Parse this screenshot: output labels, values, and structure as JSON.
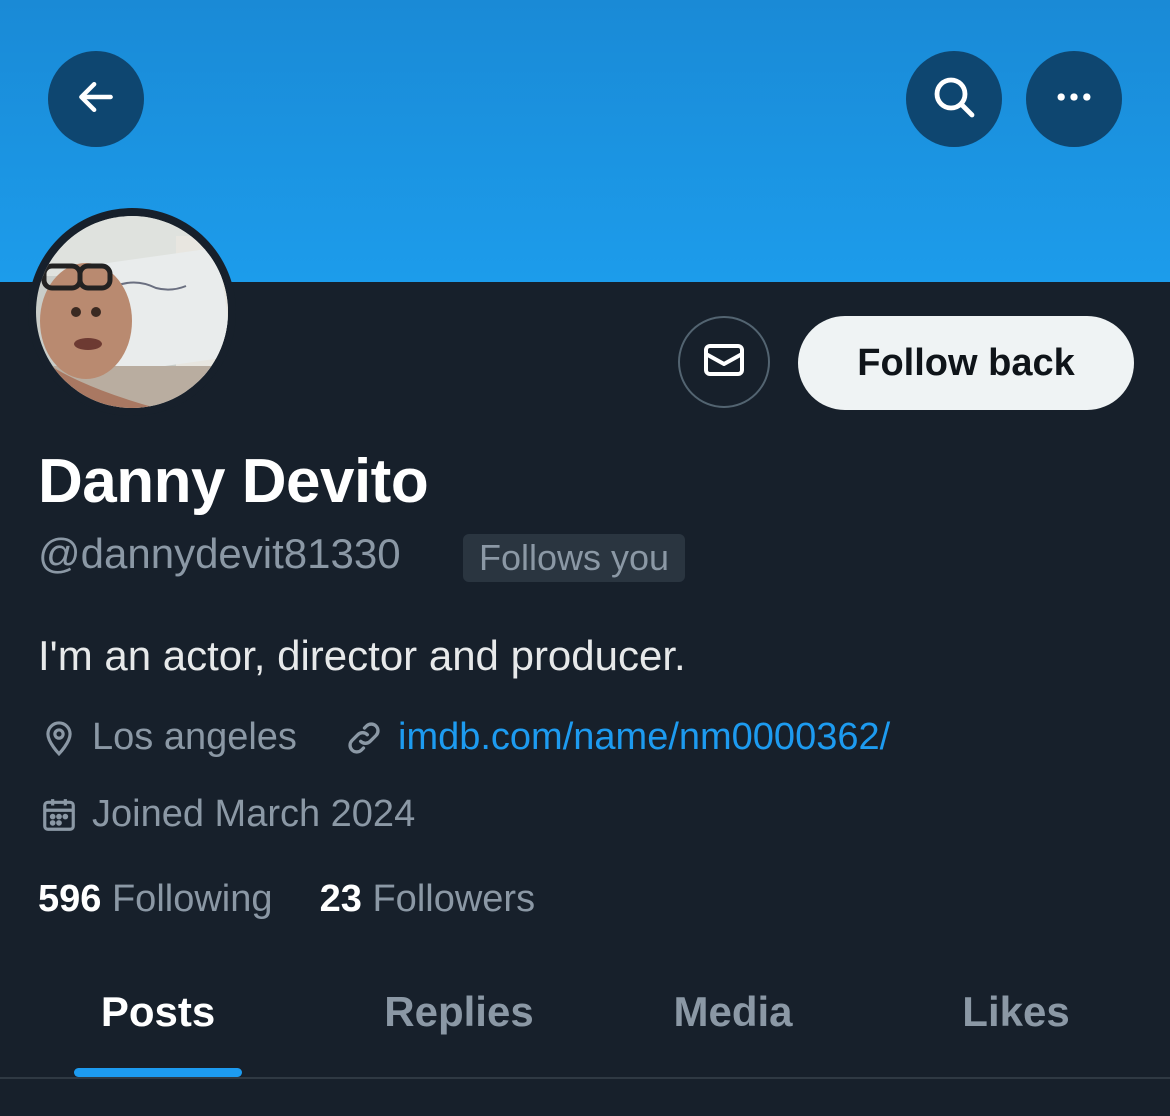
{
  "header": {
    "back_icon": "arrow-left-icon",
    "search_icon": "search-icon",
    "more_icon": "more-horizontal-icon",
    "banner_color": "#1d9bf0"
  },
  "profile": {
    "display_name": "Danny Devito",
    "handle": "@dannydevit81330",
    "follows_you_badge": "Follows you",
    "bio": "I'm an actor, director and producer.",
    "location": "Los angeles",
    "website": "imdb.com/name/nm0000362/",
    "joined": "Joined March 2024",
    "following_count": "596",
    "following_label": "Following",
    "followers_count": "23",
    "followers_label": "Followers"
  },
  "actions": {
    "message_icon": "envelope-icon",
    "follow_back_label": "Follow back"
  },
  "tabs": [
    {
      "label": "Posts",
      "active": true
    },
    {
      "label": "Replies",
      "active": false
    },
    {
      "label": "Media",
      "active": false
    },
    {
      "label": "Likes",
      "active": false
    }
  ],
  "colors": {
    "background": "#17202b",
    "accent": "#1d9bf0",
    "secondary_text": "#8b98a5"
  }
}
